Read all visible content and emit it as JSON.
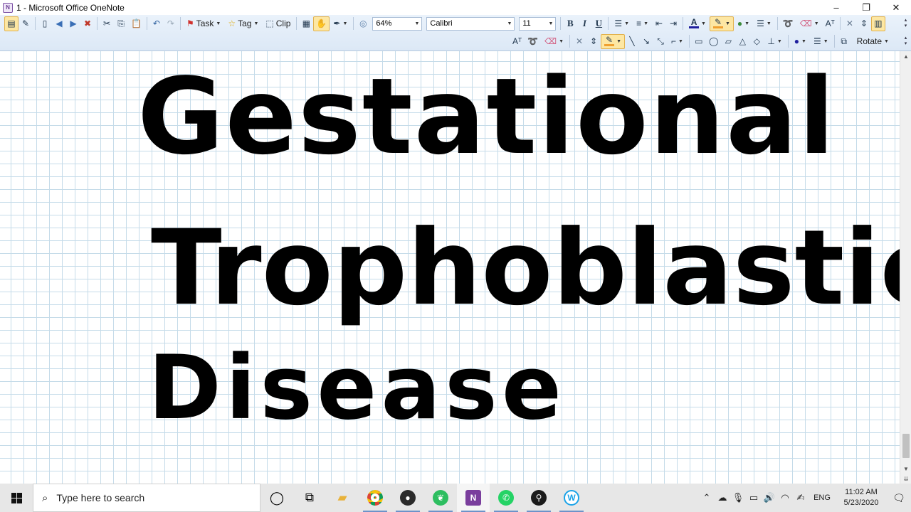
{
  "window": {
    "title": "1 - Microsoft Office OneNote",
    "app_icon": "N",
    "controls": {
      "minimize": "–",
      "restore": "❐",
      "close": "✕"
    }
  },
  "toolbar": {
    "task_label": "Task",
    "tag_label": "Tag",
    "clip_label": "Clip",
    "zoom": "64%",
    "font": "Calibri",
    "font_size": "11",
    "bold": "B",
    "italic": "I",
    "underline": "U",
    "font_color_glyph": "A",
    "rotate_label": "Rotate",
    "accent_highlight": "#f0a030",
    "pen_color": "#f0a030"
  },
  "page": {
    "ink_lines": [
      "Gestational",
      "Trophoblastic",
      "Disease"
    ]
  },
  "taskbar": {
    "search_placeholder": "Type here to search",
    "apps": [
      {
        "name": "task-view",
        "glyph": "◯"
      },
      {
        "name": "timeline",
        "glyph": "⧉"
      },
      {
        "name": "file-explorer",
        "glyph": "📁"
      },
      {
        "name": "chrome",
        "glyph": ""
      },
      {
        "name": "obs",
        "glyph": ""
      },
      {
        "name": "evernote",
        "glyph": ""
      },
      {
        "name": "onenote",
        "glyph": "N"
      },
      {
        "name": "whatsapp",
        "glyph": ""
      },
      {
        "name": "app-pin",
        "glyph": ""
      },
      {
        "name": "app-w",
        "glyph": "W"
      }
    ],
    "language": "ENG",
    "time": "11:02 AM",
    "date": "5/23/2020"
  }
}
